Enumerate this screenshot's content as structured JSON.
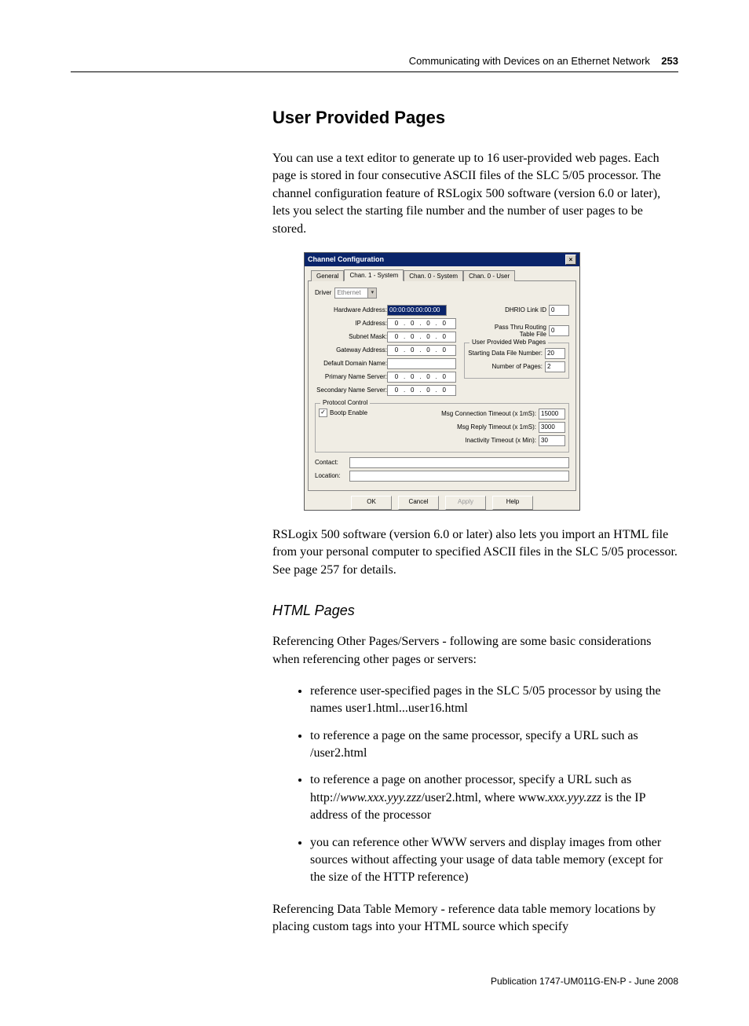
{
  "header": {
    "section_title": "Communicating with Devices on an Ethernet Network",
    "page_number": "253"
  },
  "heading": "User Provided Pages",
  "para1": "You can use a text editor to generate up to 16 user-provided web pages. Each page is stored in four consecutive ASCII files of the SLC 5/05 processor. The channel configuration feature of RSLogix 500 software (version 6.0 or later), lets you select the starting file number and the number of user pages to be stored.",
  "dialog": {
    "title": "Channel Configuration",
    "tabs": {
      "t0": "General",
      "t1": "Chan. 1 - System",
      "t2": "Chan. 0 - System",
      "t3": "Chan. 0 - User"
    },
    "driver_label": "Driver",
    "driver_value": "Ethernet",
    "fields": {
      "hw_addr_label": "Hardware Address:",
      "hw_addr_value": "00:00:00:00:00:00",
      "ip_label": "IP Address:",
      "subnet_label": "Subnet Mask:",
      "gateway_label": "Gateway Address:",
      "domain_label": "Default Domain Name:",
      "pns_label": "Primary Name Server:",
      "sns_label": "Secondary Name Server:",
      "ip_zero": "0"
    },
    "right": {
      "dhrio_label": "DHRIO Link ID",
      "dhrio_value": "0",
      "passthru_label": "Pass Thru Routing Table File",
      "passthru_value": "0",
      "group_title": "User Provided Web Pages",
      "start_file_label": "Starting Data File Number:",
      "start_file_value": "20",
      "num_pages_label": "Number of Pages:",
      "num_pages_value": "2"
    },
    "protocol": {
      "group_title": "Protocol Control",
      "bootp_label": "Bootp Enable",
      "msg_conn_label": "Msg Connection Timeout (x 1mS):",
      "msg_conn_value": "15000",
      "msg_reply_label": "Msg Reply Timeout (x 1mS):",
      "msg_reply_value": "3000",
      "inact_label": "Inactivity Timeout (x Min):",
      "inact_value": "30"
    },
    "contact_label": "Contact:",
    "location_label": "Location:",
    "buttons": {
      "ok": "OK",
      "cancel": "Cancel",
      "apply": "Apply",
      "help": "Help"
    }
  },
  "para2": "RSLogix 500 software (version 6.0 or later) also lets you import an HTML file from your personal computer to specified ASCII files in the SLC 5/05 processor. See page 257 for details.",
  "subhead": "HTML Pages",
  "para3": "Referencing Other Pages/Servers - following are some basic considerations when referencing other pages or servers:",
  "bullets": [
    "reference user-specified pages in the SLC 5/05 processor by using the names user1.html...user16.html",
    "to reference a page on the same processor, specify a URL such as /user2.html",
    "to reference a page on another processor, specify a URL such as http://www.xxx.yyy.zzz/user2.html, where www.xxx.yyy.zzz is the IP address of the processor",
    "you can reference other WWW servers and display images from other sources without affecting your usage of data table memory (except for the size of the HTTP reference)"
  ],
  "para4": "Referencing Data Table Memory - reference data table memory locations by placing custom tags into your HTML source which specify",
  "footer": "Publication 1747-UM011G-EN-P - June 2008"
}
